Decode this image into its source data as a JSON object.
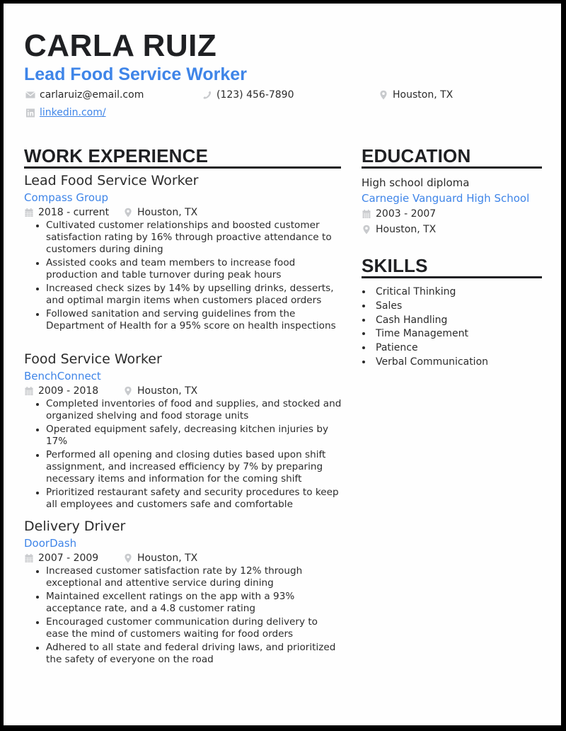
{
  "header": {
    "name": "CARLA RUIZ",
    "headline": "Lead Food Service Worker",
    "contact": {
      "email": "carlaruiz@email.com",
      "phone": "(123) 456-7890",
      "location": "Houston, TX",
      "linkedin": "linkedin.com/"
    }
  },
  "colors": {
    "accent": "#3f85e8",
    "heading": "#1f2023",
    "text": "#2b2b2b",
    "icon": "#c4c6c9",
    "frame": "#000000"
  },
  "icons": {
    "email": "envelope-icon",
    "phone": "phone-icon",
    "location": "map-pin-icon",
    "linkedin": "linkedin-icon",
    "date": "calendar-icon"
  },
  "work": {
    "title": "WORK EXPERIENCE",
    "jobs": [
      {
        "title": "Lead Food Service Worker",
        "company": "Compass Group",
        "dates": "2018 - current",
        "location": "Houston, TX",
        "bullets": [
          "Cultivated customer relationships and boosted customer satisfaction rating by 16% through proactive attendance to customers during dining",
          "Assisted cooks and team members to increase food production and table turnover during peak hours",
          "Increased check sizes by 14% by upselling drinks, desserts, and optimal margin items when customers placed orders",
          "Followed sanitation and serving guidelines from the Department of Health for a 95% score on health inspections"
        ]
      },
      {
        "title": "Food Service Worker",
        "company": "BenchConnect",
        "dates": "2009 - 2018",
        "location": "Houston, TX",
        "bullets": [
          "Completed inventories of food and supplies, and stocked and organized shelving and food storage units",
          "Operated equipment safely, decreasing kitchen injuries by 17%",
          "Performed all opening and closing duties based upon shift assignment, and increased efficiency by 7% by preparing necessary items and information for the coming shift",
          "Prioritized restaurant safety and security procedures to keep all employees and customers safe and comfortable"
        ]
      },
      {
        "title": "Delivery Driver",
        "company": "DoorDash",
        "dates": "2007 - 2009",
        "location": "Houston, TX",
        "bullets": [
          "Increased customer satisfaction rate by 12% through exceptional and attentive service during dining",
          "Maintained excellent ratings on the app with a 93% acceptance rate, and a 4.8 customer rating",
          "Encouraged customer communication during delivery to ease the mind of customers waiting for food orders",
          "Adhered to all state and federal driving laws, and prioritized the safety of everyone on the road"
        ]
      }
    ]
  },
  "education": {
    "title": "EDUCATION",
    "degree": "High school diploma",
    "school": "Carnegie Vanguard High School",
    "dates": "2003 - 2007",
    "location": "Houston, TX"
  },
  "skills": {
    "title": "SKILLS",
    "items": [
      "Critical Thinking",
      "Sales",
      "Cash Handling",
      "Time Management",
      "Patience",
      "Verbal Communication"
    ]
  }
}
